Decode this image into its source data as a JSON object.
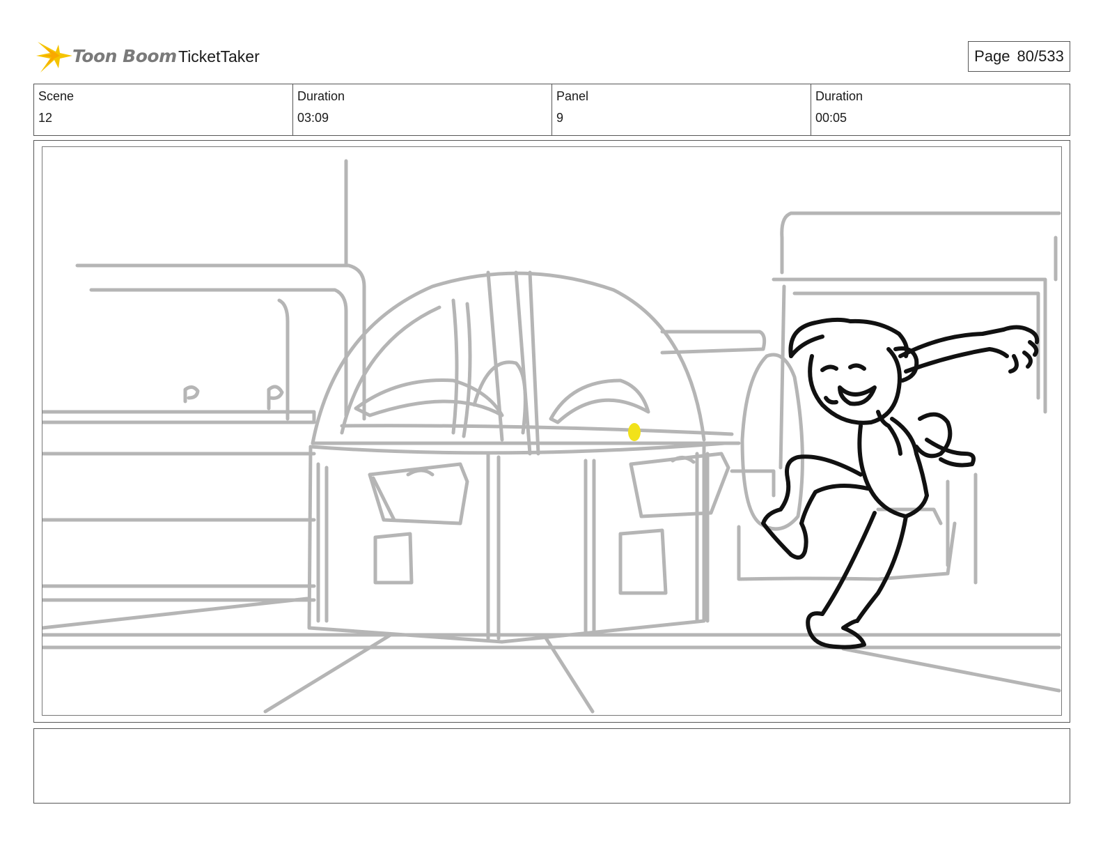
{
  "header": {
    "logo": {
      "text": "Toon Boom",
      "icon": "toon-boom-star-icon"
    },
    "project_title": "TicketTaker",
    "page_label": "Page",
    "page_number": "80/533"
  },
  "info": {
    "scene_label": "Scene",
    "scene_value": "12",
    "scene_duration_label": "Duration",
    "scene_duration_value": "03:09",
    "panel_label": "Panel",
    "panel_value": "9",
    "panel_duration_label": "Duration",
    "panel_duration_value": "00:05"
  },
  "panel": {
    "image": "storyboard-sketch",
    "colors": {
      "background_lines": "#b5b5b5",
      "character_lines": "#111111",
      "highlight": "#f2e21a"
    }
  },
  "notes": {
    "text": ""
  }
}
